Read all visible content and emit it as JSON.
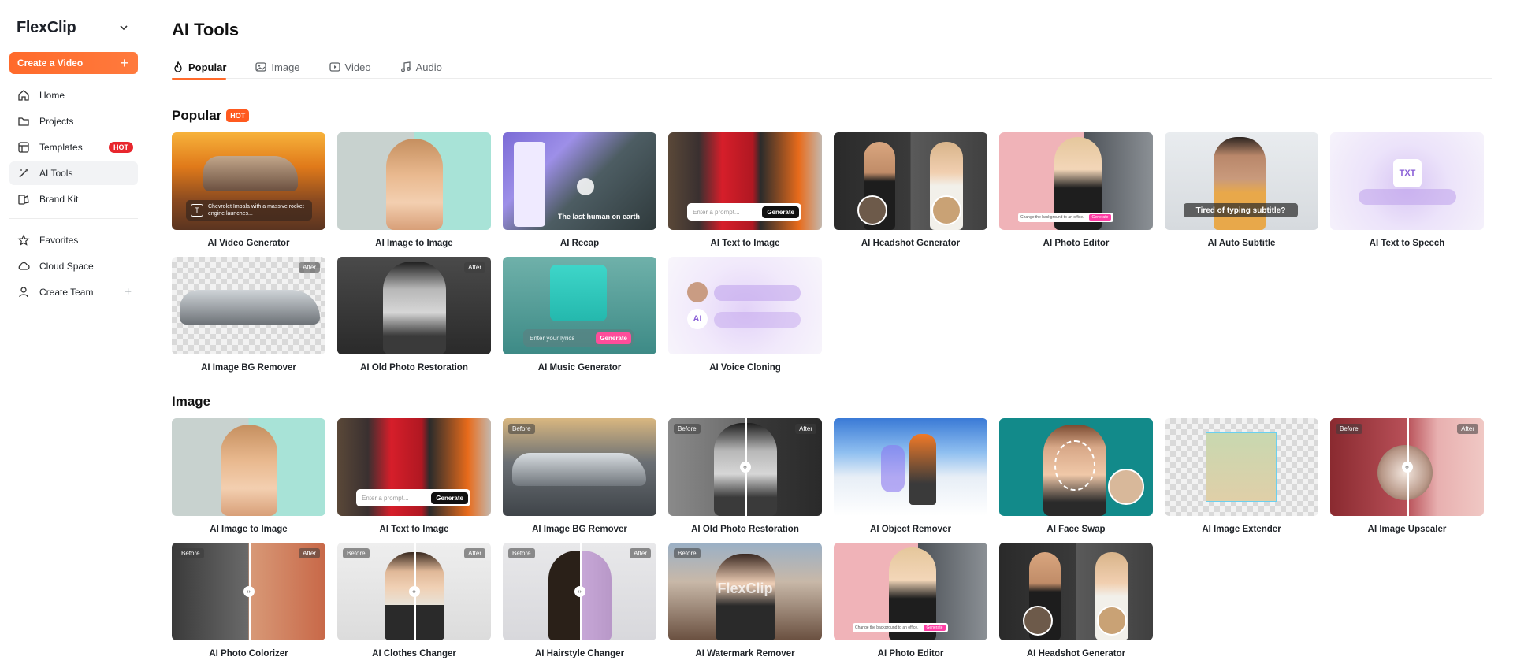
{
  "sidebar": {
    "logo": "FlexClip",
    "create_button": "Create a Video",
    "items": [
      {
        "label": "Home"
      },
      {
        "label": "Projects"
      },
      {
        "label": "Templates",
        "badge": "HOT"
      },
      {
        "label": "AI Tools"
      },
      {
        "label": "Brand Kit"
      }
    ],
    "items2": [
      {
        "label": "Favorites"
      },
      {
        "label": "Cloud Space"
      },
      {
        "label": "Create Team"
      }
    ]
  },
  "main": {
    "title": "AI Tools",
    "tabs": [
      {
        "label": "Popular"
      },
      {
        "label": "Image"
      },
      {
        "label": "Video"
      },
      {
        "label": "Audio"
      }
    ],
    "popular": {
      "title": "Popular",
      "badge": "HOT",
      "cards": [
        {
          "label": "AI Video Generator",
          "overlay": "Chevrolet Impala with a massive rocket engine launches..."
        },
        {
          "label": "AI Image to Image"
        },
        {
          "label": "AI Recap",
          "overlay": "The last human on earth"
        },
        {
          "label": "AI Text to Image",
          "placeholder": "Enter a prompt...",
          "button": "Generate"
        },
        {
          "label": "AI Headshot Generator"
        },
        {
          "label": "AI Photo Editor",
          "caption": "Change the background to an office.",
          "button": "Generate"
        },
        {
          "label": "AI Auto Subtitle",
          "overlay": "Tired of typing subtitle?"
        },
        {
          "label": "AI Text to Speech",
          "icon_text": "TXT"
        },
        {
          "label": "AI Image BG Remover",
          "tag_right": "After"
        },
        {
          "label": "AI Old Photo Restoration",
          "tag_right": "After"
        },
        {
          "label": "AI Music Generator",
          "placeholder": "Enter your lyrics",
          "button": "Generate"
        },
        {
          "label": "AI Voice Cloning",
          "icon_text": "AI"
        }
      ]
    },
    "image": {
      "title": "Image",
      "cards": [
        {
          "label": "AI Image to Image"
        },
        {
          "label": "AI Text to Image",
          "placeholder": "Enter a prompt...",
          "button": "Generate"
        },
        {
          "label": "AI Image BG Remover",
          "tag_left": "Before"
        },
        {
          "label": "AI Old Photo Restoration",
          "tag_left": "Before",
          "tag_right": "After"
        },
        {
          "label": "AI Object Remover"
        },
        {
          "label": "AI Face Swap"
        },
        {
          "label": "AI Image Extender"
        },
        {
          "label": "AI Image Upscaler",
          "tag_left": "Before",
          "tag_right": "After"
        },
        {
          "label": "AI Photo Colorizer",
          "tag_left": "Before",
          "tag_right": "After"
        },
        {
          "label": "AI Clothes Changer",
          "tag_left": "Before",
          "tag_right": "After"
        },
        {
          "label": "AI Hairstyle Changer",
          "tag_left": "Before",
          "tag_right": "After"
        },
        {
          "label": "AI Watermark Remover",
          "tag_left": "Before",
          "overlay": "FlexClip"
        },
        {
          "label": "AI Photo Editor",
          "caption": "Change the background to an office.",
          "button": "Generate"
        },
        {
          "label": "AI Headshot Generator"
        }
      ]
    }
  },
  "colors": {
    "accent": "#ff6a2b",
    "hot": "#e8262d"
  }
}
